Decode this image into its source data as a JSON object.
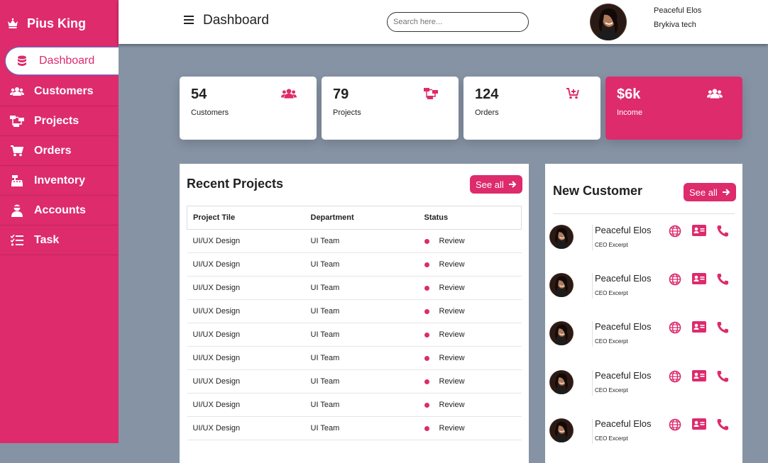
{
  "brand": {
    "name": "Pius King",
    "icon": "crown-icon"
  },
  "sidebar": {
    "items": [
      {
        "label": "Dashboard",
        "icon": "database-icon",
        "active": true
      },
      {
        "label": "Customers",
        "icon": "users-icon"
      },
      {
        "label": "Projects",
        "icon": "sitemap-icon"
      },
      {
        "label": "Orders",
        "icon": "cart-icon"
      },
      {
        "label": "Inventory",
        "icon": "cash-register-icon"
      },
      {
        "label": "Accounts",
        "icon": "user-icon"
      },
      {
        "label": "Task",
        "icon": "tasks-icon"
      }
    ]
  },
  "header": {
    "title": "Dashboard",
    "search_placeholder": "Search here...",
    "user_name": "Peaceful Elos",
    "user_org": "Brykiva tech"
  },
  "stats": [
    {
      "value": "54",
      "label": "Customers",
      "icon": "users-icon"
    },
    {
      "value": "79",
      "label": "Projects",
      "icon": "sitemap-icon"
    },
    {
      "value": "124",
      "label": "Orders",
      "icon": "cart-plus-icon"
    },
    {
      "value": "$6k",
      "label": "Income",
      "icon": "users-icon"
    }
  ],
  "recent_projects": {
    "title": "Recent Projects",
    "see_all": "See all",
    "columns": [
      "Project Tile",
      "Department",
      "Status"
    ],
    "rows": [
      [
        "UI/UX Design",
        "UI Team",
        "Review"
      ],
      [
        "UI/UX Design",
        "UI Team",
        "Review"
      ],
      [
        "UI/UX Design",
        "UI Team",
        "Review"
      ],
      [
        "UI/UX Design",
        "UI Team",
        "Review"
      ],
      [
        "UI/UX Design",
        "UI Team",
        "Review"
      ],
      [
        "UI/UX Design",
        "UI Team",
        "Review"
      ],
      [
        "UI/UX Design",
        "UI Team",
        "Review"
      ],
      [
        "UI/UX Design",
        "UI Team",
        "Review"
      ],
      [
        "UI/UX Design",
        "UI Team",
        "Review"
      ]
    ]
  },
  "new_customer": {
    "title": "New Customer",
    "see_all": "See all",
    "customers": [
      {
        "name": "Peaceful Elos",
        "role": "CEO Excerpt"
      },
      {
        "name": "Peaceful Elos",
        "role": "CEO Excerpt"
      },
      {
        "name": "Peaceful Elos",
        "role": "CEO Excerpt"
      },
      {
        "name": "Peaceful Elos",
        "role": "CEO Excerpt"
      },
      {
        "name": "Peaceful Elos",
        "role": "CEO Excerpt"
      }
    ]
  },
  "colors": {
    "accent": "#dd2b6c",
    "background": "#8693a4"
  }
}
